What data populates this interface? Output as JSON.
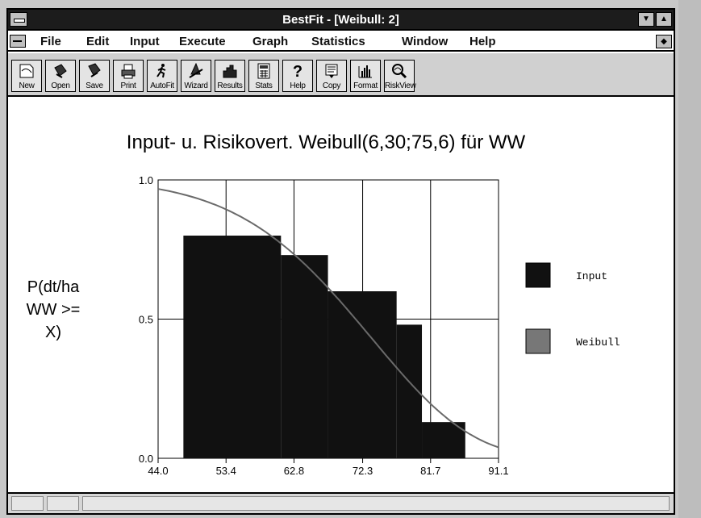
{
  "window": {
    "title": "BestFit - [Weibull: 2]"
  },
  "menu": [
    "File",
    "Edit",
    "Input",
    "Execute",
    "Graph",
    "Statistics",
    "Window",
    "Help"
  ],
  "toolbar": [
    {
      "label": "New",
      "icon": "new-icon"
    },
    {
      "label": "Open",
      "icon": "open-icon"
    },
    {
      "label": "Save",
      "icon": "save-icon"
    },
    {
      "label": "Print",
      "icon": "print-icon"
    },
    {
      "label": "AutoFit",
      "icon": "autofit-icon"
    },
    {
      "label": "Wizard",
      "icon": "wizard-icon"
    },
    {
      "label": "Results",
      "icon": "results-icon"
    },
    {
      "label": "Stats",
      "icon": "stats-icon"
    },
    {
      "label": "Help",
      "icon": "help-icon"
    },
    {
      "label": "Copy",
      "icon": "copy-icon"
    },
    {
      "label": "Format",
      "icon": "format-icon"
    },
    {
      "label": "RiskView",
      "icon": "riskview-icon"
    }
  ],
  "chart_data": {
    "type": "bar",
    "title": "Input- u. Risikovert. Weibull(6,30;75,6) für WW",
    "ylabel": "P(dt/ha WW >= X)",
    "ylabel_lines": [
      "P(dt/ha",
      "WW >=",
      "X)"
    ],
    "xlim": [
      44.0,
      91.1
    ],
    "ylim": [
      0.0,
      1.0
    ],
    "xticks": [
      "44.0",
      "53.4",
      "62.8",
      "72.3",
      "81.7",
      "91.1"
    ],
    "yticks": [
      "0.0",
      "0.5",
      "1.0"
    ],
    "grid": true,
    "legend_position": "right",
    "series": [
      {
        "name": "Input",
        "kind": "step-bars",
        "color": "#111111",
        "bins": [
          {
            "x0": 47.5,
            "x1": 61.0,
            "y": 0.8
          },
          {
            "x0": 61.0,
            "x1": 67.5,
            "y": 0.73
          },
          {
            "x0": 67.5,
            "x1": 77.0,
            "y": 0.6
          },
          {
            "x0": 77.0,
            "x1": 80.5,
            "y": 0.48
          },
          {
            "x0": 80.5,
            "x1": 86.5,
            "y": 0.13
          }
        ]
      },
      {
        "name": "Weibull",
        "kind": "line",
        "color": "#6a6a6a",
        "shape": 6.3,
        "scale": 75.6
      }
    ]
  },
  "colors": {
    "titlebar": "#1c1c1c",
    "plot_fill": "#111111",
    "weibull_line": "#6a6a6a"
  }
}
